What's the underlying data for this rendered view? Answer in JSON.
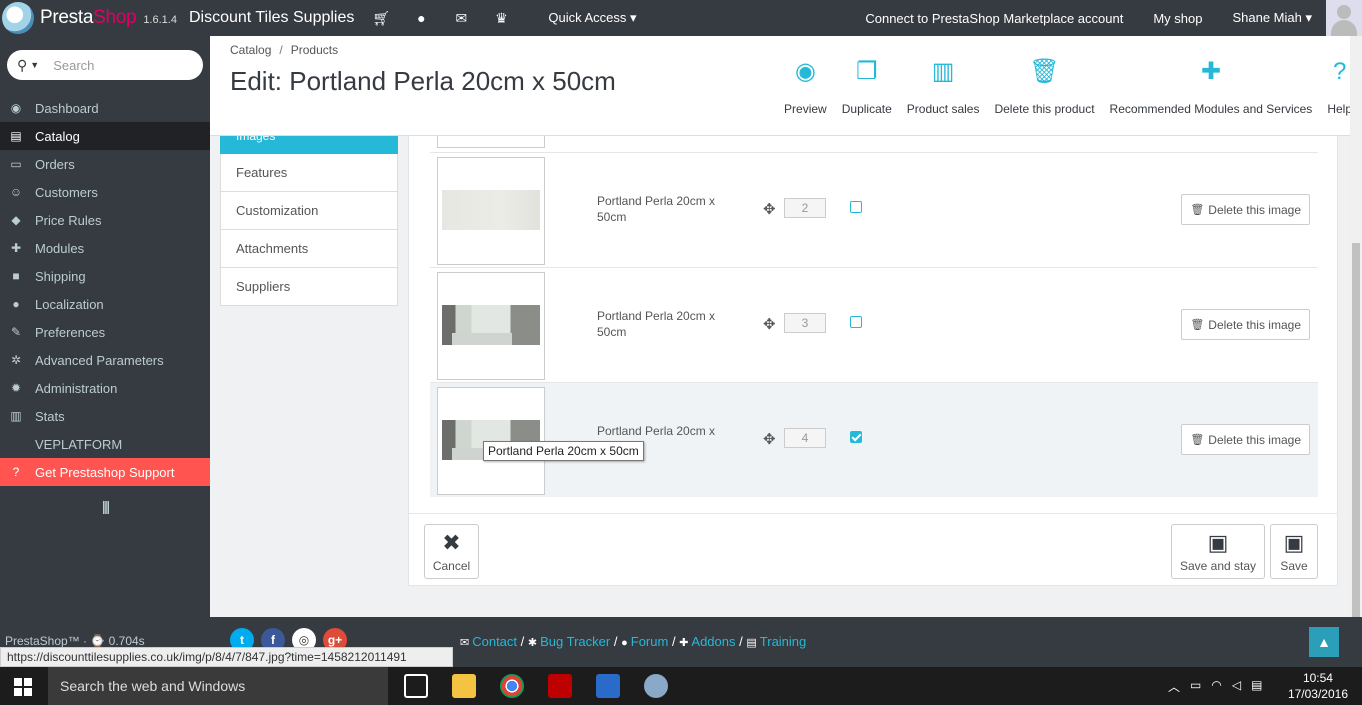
{
  "topbar": {
    "brand_presta": "Presta",
    "brand_shop": "Shop",
    "version": "1.6.1.4",
    "shop_name": "Discount Tiles Supplies",
    "quick_access": "Quick Access ▾",
    "marketplace": "Connect to PrestaShop Marketplace account",
    "my_shop": "My shop",
    "user": "Shane Miah ▾"
  },
  "sidebar": {
    "search_placeholder": "Search",
    "items": [
      {
        "label": "Dashboard",
        "icon": "dashboard-icon",
        "glyph": "◉"
      },
      {
        "label": "Catalog",
        "icon": "book-icon",
        "glyph": "▤"
      },
      {
        "label": "Orders",
        "icon": "credit-card-icon",
        "glyph": "▭"
      },
      {
        "label": "Customers",
        "icon": "users-icon",
        "glyph": "☺"
      },
      {
        "label": "Price Rules",
        "icon": "tags-icon",
        "glyph": "◆"
      },
      {
        "label": "Modules",
        "icon": "puzzle-icon",
        "glyph": "✚"
      },
      {
        "label": "Shipping",
        "icon": "truck-icon",
        "glyph": "■"
      },
      {
        "label": "Localization",
        "icon": "globe-icon",
        "glyph": "●"
      },
      {
        "label": "Preferences",
        "icon": "wrench-icon",
        "glyph": "✎"
      },
      {
        "label": "Advanced Parameters",
        "icon": "gears-icon",
        "glyph": "✲"
      },
      {
        "label": "Administration",
        "icon": "gear-icon",
        "glyph": "✹"
      },
      {
        "label": "Stats",
        "icon": "bar-chart-icon",
        "glyph": "▥"
      },
      {
        "label": "VEPLATFORM",
        "icon": "",
        "glyph": ""
      },
      {
        "label": "Get Prestashop Support",
        "icon": "question-icon",
        "glyph": "?"
      }
    ]
  },
  "header": {
    "breadcrumb_1": "Catalog",
    "breadcrumb_sep": "/",
    "breadcrumb_2": "Products",
    "title": "Edit: Portland Perla 20cm x 50cm",
    "toolbar": [
      {
        "label": "Preview",
        "icon": "eye-icon",
        "glyph": "◉"
      },
      {
        "label": "Duplicate",
        "icon": "copy-icon",
        "glyph": "❐"
      },
      {
        "label": "Product sales",
        "icon": "bar-chart-icon",
        "glyph": "▥"
      },
      {
        "label": "Delete this product",
        "icon": "trash-icon",
        "glyph": "🗑"
      },
      {
        "label": "Recommended Modules and Services",
        "icon": "puzzle-icon",
        "glyph": "✚"
      },
      {
        "label": "Help",
        "icon": "help-icon",
        "glyph": "?"
      }
    ]
  },
  "tabs": {
    "active": "Images",
    "items": [
      "Features",
      "Customization",
      "Attachments",
      "Suppliers"
    ]
  },
  "images": {
    "rows": [
      {
        "legend": "Portland Perla 20cm x 50cm",
        "position": "2",
        "cover": false,
        "style": "plain"
      },
      {
        "legend": "Portland Perla 20cm x 50cm",
        "position": "3",
        "cover": false,
        "style": "bath"
      },
      {
        "legend": "Portland Perla 20cm x",
        "position": "4",
        "cover": true,
        "style": "bath"
      }
    ],
    "delete_label": "Delete this image",
    "tooltip": "Portland Perla 20cm x 50cm"
  },
  "buttons": {
    "cancel": "Cancel",
    "save_and_stay": "Save and stay",
    "save": "Save"
  },
  "footer": {
    "powered": "PrestaShop™ · ⌚ 0.704s",
    "contact": "Contact",
    "bug_tracker": "Bug Tracker",
    "forum": "Forum",
    "addons": "Addons",
    "training": "Training",
    "sep": "/",
    "status_url": "https://discounttilesupplies.co.uk/img/p/8/4/7/847.jpg?time=1458212011491"
  },
  "taskbar": {
    "search": "Search the web and Windows",
    "time": "10:54",
    "date": "17/03/2016"
  },
  "colors": {
    "accent": "#25b9d7",
    "dark": "#363a41",
    "support": "#ff5450",
    "brand_pink": "#df0067"
  }
}
